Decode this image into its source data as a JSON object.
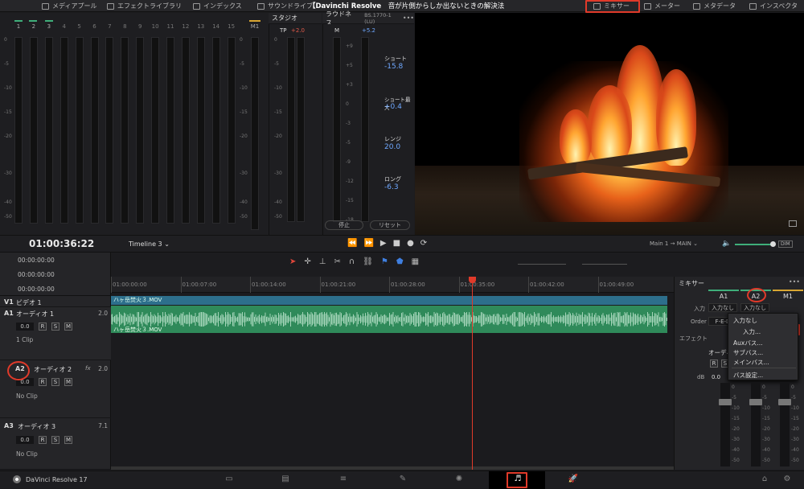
{
  "topbar": {
    "media_pool": "メディアプール",
    "effects_library": "エフェクトライブラリ",
    "index": "インデックス",
    "sound_library": "サウンドライブ",
    "title_app": "【Davinchi Resolve",
    "title_rest": "音が片側からしか出ないときの解決法",
    "mixer": "ミキサー",
    "meter": "メーター",
    "metadata": "メタデータ",
    "inspector": "インスペクタ"
  },
  "meters": {
    "channels": [
      "1",
      "2",
      "3",
      "4",
      "5",
      "6",
      "7",
      "8",
      "9",
      "10",
      "11",
      "12",
      "13",
      "14",
      "15"
    ],
    "scale": [
      "0",
      "-5",
      "-10",
      "-15",
      "-20",
      "-30",
      "-40",
      "-50"
    ],
    "master": "M1"
  },
  "studio": {
    "title": "スタジオ",
    "tp_label": "TP",
    "tp_value": "+2.0",
    "scale": [
      "0",
      "-5",
      "-10",
      "-15",
      "-20",
      "-30",
      "-40",
      "-50"
    ]
  },
  "loudness": {
    "title": "ラウドネス",
    "standard": "BS.1770-1 (LU)",
    "m_label": "M",
    "m_value": "+5.2",
    "scale": [
      "+9",
      "+5",
      "+3",
      "0",
      "-3",
      "-5",
      "-9",
      "-12",
      "-15",
      "-18"
    ],
    "short_label": "ショート",
    "short_value": "-15.8",
    "short_max_label": "ショート最大",
    "short_max_value": "+0.4",
    "range_label": "レンジ",
    "range_value": "20.0",
    "long_label": "ロング",
    "long_value": "-6.3",
    "pause_button": "停止",
    "reset_button": "リセット"
  },
  "transport": {
    "timecode": "01:00:36:22",
    "timeline_name": "Timeline 3",
    "output": "Main 1",
    "arrow": "→",
    "main_bus": "MAIN",
    "dim": "DIM"
  },
  "timecodes": [
    "00:00:00:00",
    "00:00:00:00",
    "00:00:00:00"
  ],
  "ruler": [
    "01:00:00:00",
    "01:00:07:00",
    "01:00:14:00",
    "01:00:21:00",
    "01:00:28:00",
    "01:00:35:00",
    "01:00:42:00",
    "01:00:49:00"
  ],
  "tracks": {
    "v1": {
      "id": "V1",
      "name": "ビデオ 1"
    },
    "a1": {
      "id": "A1",
      "name": "オーディオ 1",
      "channels": "2.0",
      "volume": "0.0",
      "clips": "1 Clip"
    },
    "a2": {
      "id": "A2",
      "name": "オーディオ 2",
      "fx": "fx",
      "channels": "2.0",
      "volume": "0.0",
      "clips": "No Clip"
    },
    "a3": {
      "id": "A3",
      "name": "オーディオ 3",
      "channels": "7.1",
      "volume": "0.0",
      "clips": "No Clip"
    },
    "buttons": [
      "R",
      "S",
      "M"
    ]
  },
  "clips": {
    "video": "ハヶ岳焚火３.MOV",
    "audio": "ハヶ岳焚火３.MOV"
  },
  "mixer": {
    "title": "ミキサー",
    "cols": [
      "A1",
      "A2",
      "M1"
    ],
    "input_label": "入力",
    "input_none": "入力なし",
    "order_label": "Order",
    "order_value": "F-E-D",
    "effects_label": "エフェクト",
    "audio_label": "オーディ",
    "db_label": "dB",
    "vol": "0.0",
    "r": "R",
    "s": "S",
    "scale": [
      "0",
      "-5",
      "-10",
      "-15",
      "-20",
      "-30",
      "-40",
      "-50"
    ]
  },
  "dropdown": {
    "items": [
      "入力なし",
      "入力...",
      "Auxバス...",
      "サブバス...",
      "メインバス...",
      "バス設定..."
    ]
  },
  "bottombar": {
    "app_name": "DaVinci Resolve 17"
  }
}
